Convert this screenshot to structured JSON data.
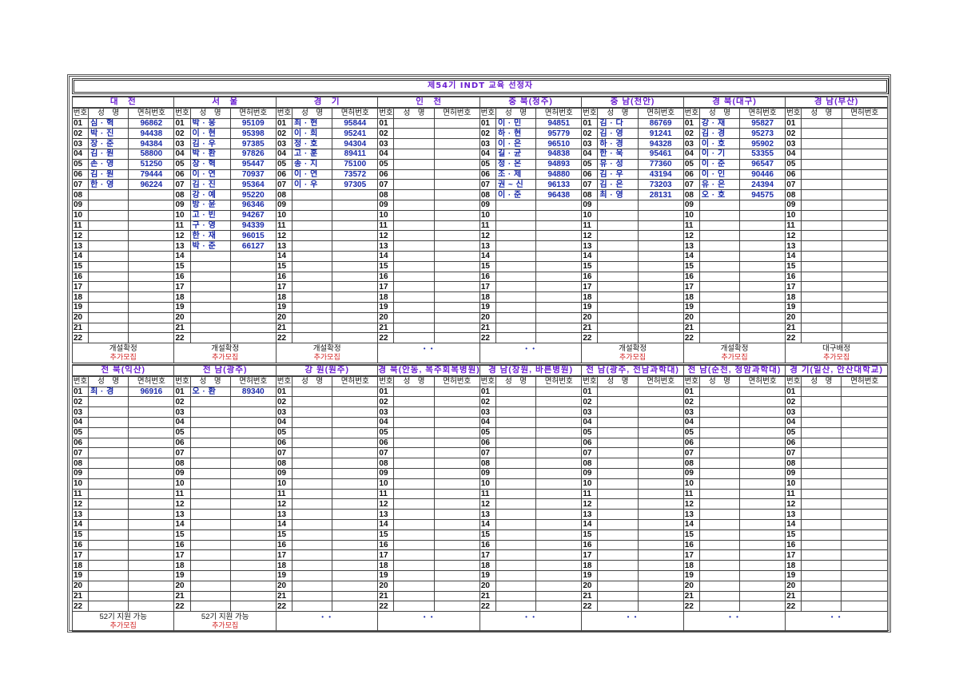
{
  "title": "제54기 INDT 교육 선정자",
  "headers": {
    "num": "번호",
    "name": "성　명",
    "license": "면허번호"
  },
  "row_numbers": [
    "01",
    "02",
    "03",
    "04",
    "05",
    "06",
    "07",
    "08",
    "09",
    "10",
    "11",
    "12",
    "13",
    "14",
    "15",
    "16",
    "17",
    "18",
    "19",
    "20",
    "21",
    "22"
  ],
  "top_regions": [
    {
      "region": "대　전",
      "status": "개설확정",
      "note": "추가모집",
      "entries": [
        [
          "심 · 혁",
          "96862"
        ],
        [
          "박 · 진",
          "94438"
        ],
        [
          "장 · 준",
          "94384"
        ],
        [
          "김 · 원",
          "58800"
        ],
        [
          "손 · 영",
          "51250"
        ],
        [
          "김 · 원",
          "79444"
        ],
        [
          "한 · 영",
          "96224"
        ]
      ]
    },
    {
      "region": "서　울",
      "status": "개설확정",
      "note": "추가모집",
      "entries": [
        [
          "박 · 웅",
          "95109"
        ],
        [
          "이 · 현",
          "95398"
        ],
        [
          "김 · 우",
          "97385"
        ],
        [
          "박 · 환",
          "97826"
        ],
        [
          "장 · 혁",
          "95447"
        ],
        [
          "이 · 연",
          "70937"
        ],
        [
          "김 · 진",
          "95364"
        ],
        [
          "강 · 예",
          "95220"
        ],
        [
          "방 · 윤",
          "96346"
        ],
        [
          "고 · 빈",
          "94267"
        ],
        [
          "구 · 영",
          "94339"
        ],
        [
          "한 · 재",
          "96015"
        ],
        [
          "박 · 준",
          "66127"
        ]
      ]
    },
    {
      "region": "경　기",
      "status": "개설확정",
      "note": "추가모집",
      "entries": [
        [
          "최 · 현",
          "95844"
        ],
        [
          "이 · 희",
          "95241"
        ],
        [
          "정 · 호",
          "94304"
        ],
        [
          "고 · 훈",
          "89411"
        ],
        [
          "송 · 지",
          "75100"
        ],
        [
          "이 · 연",
          "73572"
        ],
        [
          "이 · 우",
          "97305"
        ]
      ]
    },
    {
      "region": "인　천",
      "status": "• •",
      "note": "",
      "entries": []
    },
    {
      "region": "충 북(청주)",
      "status": "• •",
      "note": "",
      "entries": [
        [
          "이 · 민",
          "94851"
        ],
        [
          "하 · 현",
          "95779"
        ],
        [
          "이 · 은",
          "96510"
        ],
        [
          "길 · 균",
          "94838"
        ],
        [
          "정 · 온",
          "94893"
        ],
        [
          "조 · 제",
          "94880"
        ],
        [
          "권 ~ 신",
          "96133"
        ],
        [
          "이 · 준",
          "96438"
        ]
      ]
    },
    {
      "region": "충 남(천안)",
      "status": "개설확정",
      "note": "추가모집",
      "entries": [
        [
          "김 · 다",
          "86769"
        ],
        [
          "김 · 영",
          "91241"
        ],
        [
          "하 · 경",
          "94328"
        ],
        [
          "한 · 욱",
          "95461"
        ],
        [
          "유 · 성",
          "77360"
        ],
        [
          "김 · 우",
          "43194"
        ],
        [
          "김 · 은",
          "73203"
        ],
        [
          "최 · 영",
          "28131"
        ]
      ]
    },
    {
      "region": "경 북(대구)",
      "status": "개설확정",
      "note": "추가모집",
      "entries": [
        [
          "강 · 재",
          "95827"
        ],
        [
          "김 · 경",
          "95273"
        ],
        [
          "이 · 호",
          "95902"
        ],
        [
          "이 · 기",
          "53355"
        ],
        [
          "이 · 준",
          "96547"
        ],
        [
          "이 · 인",
          "90446"
        ],
        [
          "유 · 은",
          "24394"
        ],
        [
          "오 · 호",
          "94575"
        ]
      ]
    },
    {
      "region": "경 남(부산)",
      "status": "대구배정",
      "note": "추가모집",
      "entries": []
    }
  ],
  "bottom_regions": [
    {
      "region": "전 북(익산)",
      "status": "52기 지원 가능",
      "note": "추가모집",
      "entries": [
        [
          "최 · 경",
          "96916"
        ]
      ]
    },
    {
      "region": "전 남(광주)",
      "status": "52기 지원 가능",
      "note": "추가모집",
      "entries": [
        [
          "오 · 환",
          "89340"
        ]
      ]
    },
    {
      "region": "강 원(원주)",
      "status": "• •",
      "note": "",
      "entries": []
    },
    {
      "region": "경 북(안동, 복주회복병원)",
      "status": "• •",
      "note": "",
      "entries": []
    },
    {
      "region": "경 남(창원, 바른병원)",
      "status": "• •",
      "note": "",
      "entries": []
    },
    {
      "region": "전 남(광주, 전남과학대)",
      "status": "• •",
      "note": "",
      "entries": []
    },
    {
      "region": "전 남(순천, 청암과학대)",
      "status": "• •",
      "note": "",
      "entries": []
    },
    {
      "region": "경 기(일산, 안산대학교)",
      "status": "• •",
      "note": "",
      "entries": []
    }
  ],
  "colors": {
    "title": "#6a1fd0",
    "name": "#1a2aa8",
    "note": "#d02020"
  }
}
